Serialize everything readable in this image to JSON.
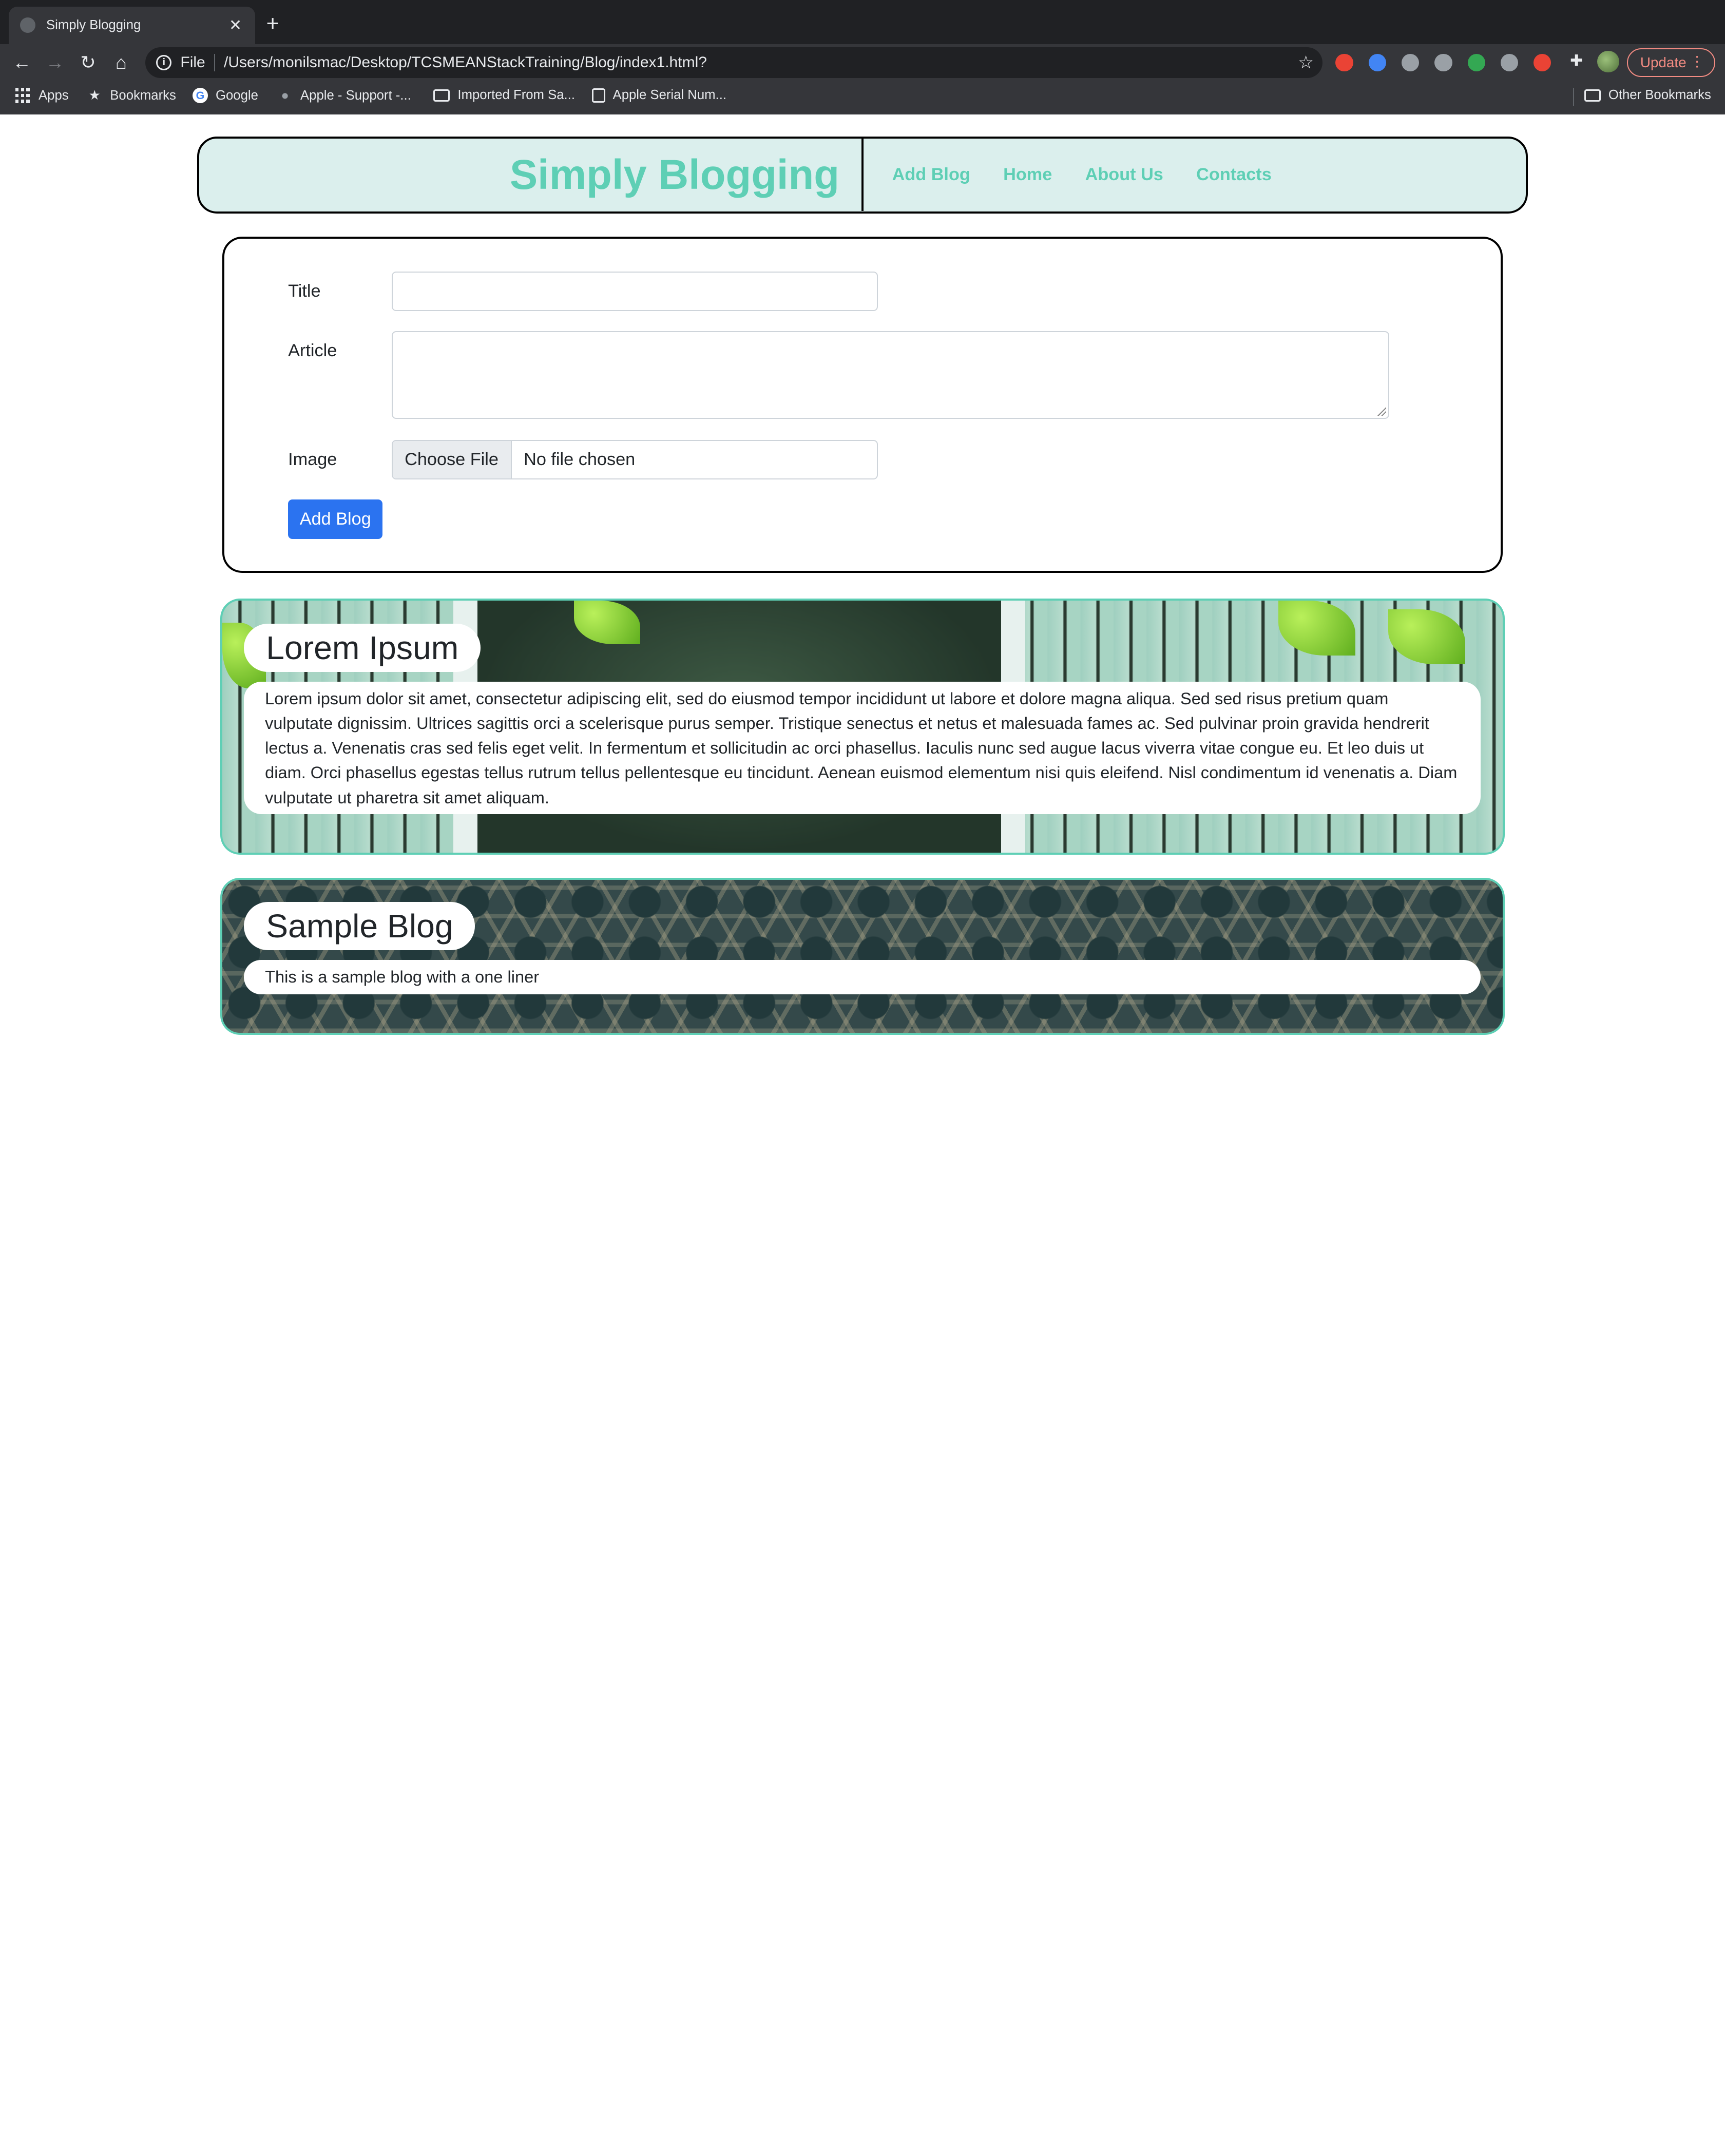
{
  "browser": {
    "tab_title": "Simply Blogging",
    "tab_close": "✕",
    "new_tab": "+",
    "scheme": "File",
    "url": "/Users/monilsmac/Desktop/TCSMEANStackTraining/Blog/index1.html?",
    "update_label": "Update",
    "bookmarks": [
      "Apps",
      "Bookmarks",
      "Google",
      "Apple - Support -...",
      "Imported From Sa...",
      "Apple Serial Num..."
    ],
    "other_bookmarks": "Other Bookmarks",
    "extension_colors": [
      "#ea4335",
      "#4285f4",
      "#9aa0a6",
      "#9aa0a6",
      "#34a853",
      "#9aa0a6",
      "#ea4335"
    ]
  },
  "header": {
    "site_title": "Simply Blogging",
    "nav": [
      "Add Blog",
      "Home",
      "About Us",
      "Contacts"
    ]
  },
  "form": {
    "title_label": "Title",
    "title_value": "",
    "article_label": "Article",
    "article_value": "",
    "image_label": "Image",
    "choose_file": "Choose File",
    "file_status": "No file chosen",
    "submit_label": "Add Blog"
  },
  "blogs": [
    {
      "title": "Lorem Ipsum",
      "body": "Lorem ipsum dolor sit amet, consectetur adipiscing elit, sed do eiusmod tempor incididunt ut labore et dolore magna aliqua. Sed sed risus pretium quam vulputate dignissim. Ultrices sagittis orci a scelerisque purus semper. Tristique senectus et netus et malesuada fames ac. Sed pulvinar proin gravida hendrerit lectus a. Venenatis cras sed felis eget velit. In fermentum et sollicitudin ac orci phasellus. Iaculis nunc sed augue lacus viverra vitae congue eu. Et leo duis ut diam. Orci phasellus egestas tellus rutrum tellus pellentesque eu tincidunt. Aenean euismod elementum nisi quis eleifend. Nisl condimentum id venenatis a. Diam vulputate ut pharetra sit amet aliquam."
    },
    {
      "title": "Sample Blog",
      "body": "This is a sample blog with a one liner"
    }
  ],
  "colors": {
    "accent": "#5ecfb5",
    "header_bg": "#dbefed",
    "primary_button": "#2b73f0"
  }
}
